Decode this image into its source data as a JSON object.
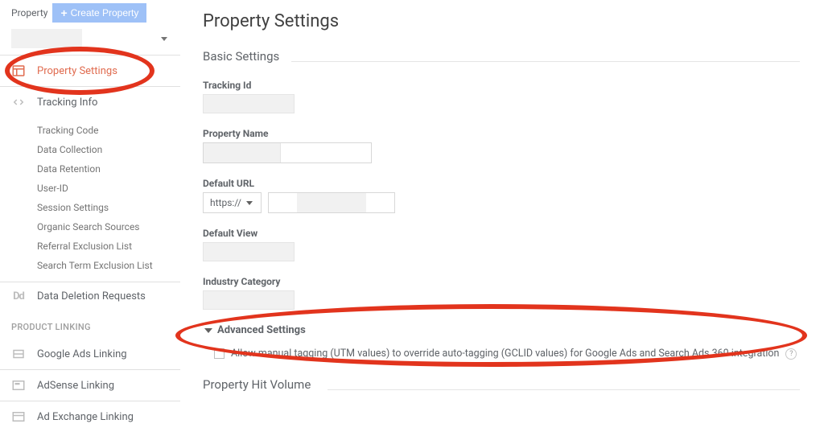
{
  "sidebar": {
    "top_label": "Property",
    "create_label": "Create Property",
    "items": {
      "property_settings": "Property Settings",
      "tracking_info": "Tracking Info",
      "data_deletion": "Data Deletion Requests"
    },
    "tracking_sub": [
      "Tracking Code",
      "Data Collection",
      "Data Retention",
      "User-ID",
      "Session Settings",
      "Organic Search Sources",
      "Referral Exclusion List",
      "Search Term Exclusion List"
    ],
    "product_linking_header": "PRODUCT LINKING",
    "product_linking": [
      "Google Ads Linking",
      "AdSense Linking",
      "Ad Exchange Linking"
    ]
  },
  "main": {
    "title": "Property Settings",
    "basic_settings": "Basic Settings",
    "fields": {
      "tracking_id": "Tracking Id",
      "property_name": "Property Name",
      "default_url": "Default URL",
      "protocol": "https://",
      "default_view": "Default View",
      "industry_category": "Industry Category"
    },
    "advanced": {
      "label": "Advanced Settings",
      "checkbox_text": "Allow manual tagging (UTM values) to override auto-tagging (GCLID values) for Google Ads and Search Ads 360 integration"
    },
    "property_hit_volume": "Property Hit Volume"
  }
}
